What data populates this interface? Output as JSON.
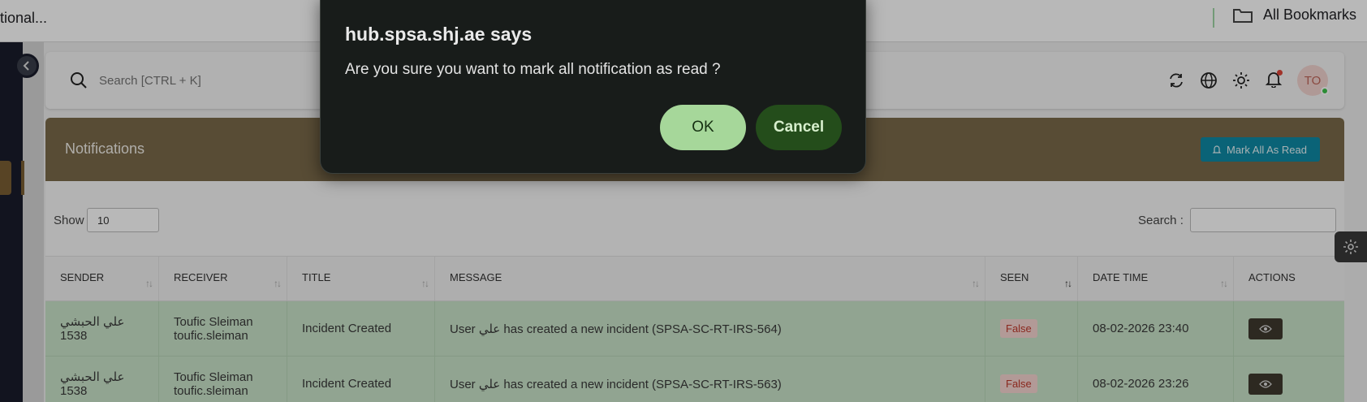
{
  "browser": {
    "tab_title": "tional...",
    "bookmarks_label": "All Bookmarks"
  },
  "topbar": {
    "search_placeholder": "Search [CTRL + K]",
    "avatar_initials": "TO"
  },
  "notifications": {
    "title": "Notifications",
    "mark_all_label": "Mark All As Read",
    "show_label": "Show",
    "show_value": "10",
    "search_label": "Search :"
  },
  "table": {
    "columns": [
      "SENDER",
      "RECEIVER",
      "TITLE",
      "MESSAGE",
      "SEEN",
      "DATE TIME",
      "ACTIONS"
    ],
    "rows": [
      {
        "sender_name": "علي الحبشي",
        "sender_id": "1538",
        "receiver_name": "Toufic Sleiman",
        "receiver_user": "toufic.sleiman",
        "title": "Incident Created",
        "message": "User علي has created a new incident (SPSA-SC-RT-IRS-564)",
        "seen": "False",
        "datetime": "08-02-2026 23:40"
      },
      {
        "sender_name": "علي الحبشي",
        "sender_id": "1538",
        "receiver_name": "Toufic Sleiman",
        "receiver_user": "toufic.sleiman",
        "title": "Incident Created",
        "message": "User علي has created a new incident (SPSA-SC-RT-IRS-563)",
        "seen": "False",
        "datetime": "08-02-2026 23:26"
      }
    ]
  },
  "dialog": {
    "title": "hub.spsa.shj.ae says",
    "message": "Are you sure you want to mark all notification as read ?",
    "ok_label": "OK",
    "cancel_label": "Cancel"
  },
  "colors": {
    "header_bg": "#7a6a4a",
    "row_bg": "#c9e3c9",
    "mark_read_btn": "#0f8aa5",
    "dialog_bg": "#181c1a",
    "ok_btn": "#a6d79a",
    "cancel_btn": "#244d1b"
  }
}
